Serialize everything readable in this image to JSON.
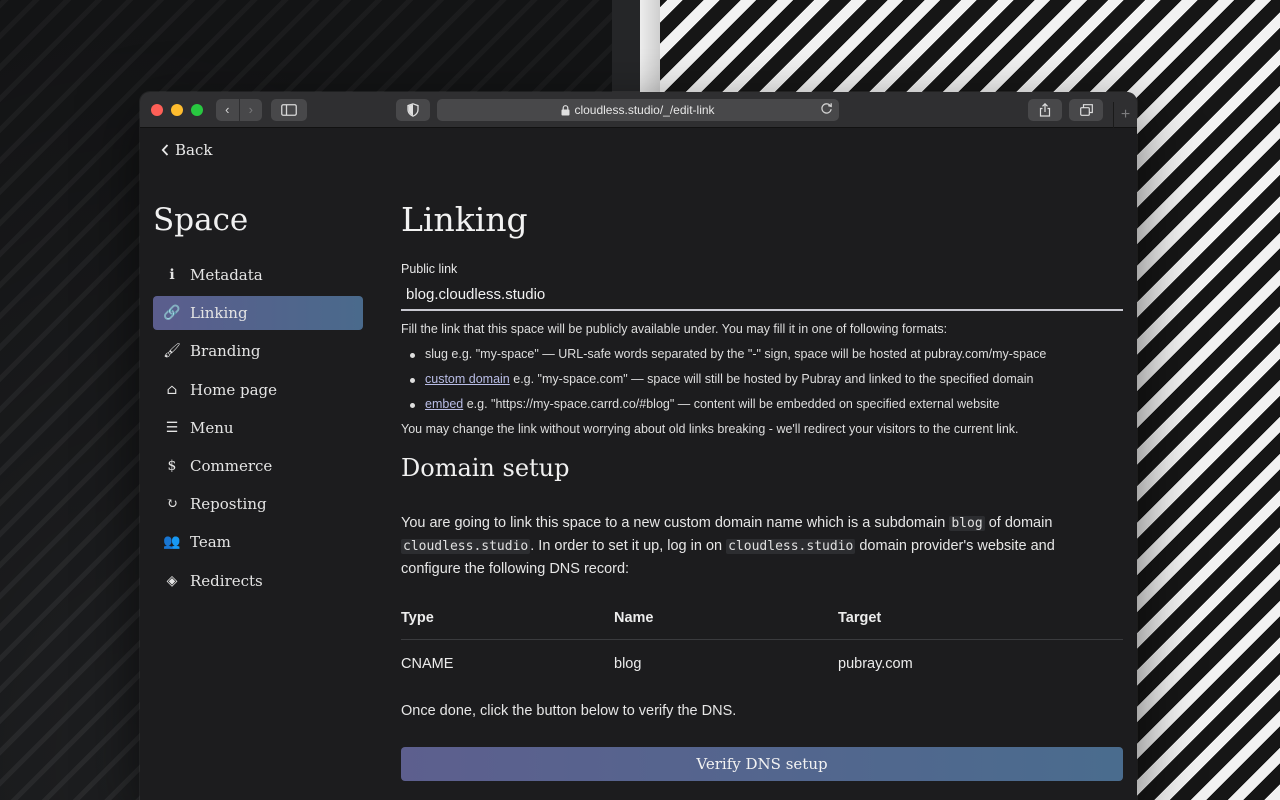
{
  "browser": {
    "url": "cloudless.studio/_/edit-link",
    "nav_back_glyph": "‹",
    "nav_forward_glyph": "›",
    "new_tab_glyph": "+"
  },
  "page": {
    "back_label": "Back",
    "space_title": "Space"
  },
  "sidebar": {
    "items": [
      {
        "label": "Metadata",
        "icon": "info-icon",
        "glyph": "ℹ"
      },
      {
        "label": "Linking",
        "icon": "link-icon",
        "glyph": "🔗",
        "active": true
      },
      {
        "label": "Branding",
        "icon": "brush-icon",
        "glyph": "🖌"
      },
      {
        "label": "Home page",
        "icon": "home-icon",
        "glyph": "⌂"
      },
      {
        "label": "Menu",
        "icon": "menu-icon",
        "glyph": "☰"
      },
      {
        "label": "Commerce",
        "icon": "dollar-icon",
        "glyph": "$"
      },
      {
        "label": "Reposting",
        "icon": "redo-icon",
        "glyph": "↻"
      },
      {
        "label": "Team",
        "icon": "users-icon",
        "glyph": "👥"
      },
      {
        "label": "Redirects",
        "icon": "directions-icon",
        "glyph": "◈"
      }
    ]
  },
  "linking": {
    "title": "Linking",
    "public_link_label": "Public link",
    "public_link_value": "blog.cloudless.studio",
    "intro": "Fill the link that this space will be publicly available under. You may fill it in one of following formats:",
    "formats": [
      {
        "link": "",
        "text": "slug e.g. \"my-space\" — URL-safe words separated by the \"-\" sign, space will be hosted at pubray.com/my-space"
      },
      {
        "link": "custom domain",
        "text": " e.g. \"my-space.com\" — space will still be hosted by Pubray and linked to the specified domain"
      },
      {
        "link": "embed",
        "text": " e.g. \"https://my-space.carrd.co/#blog\" — content will be embedded on specified external website"
      }
    ],
    "note": "You may change the link without worrying about old links breaking - we'll redirect your visitors to the current link."
  },
  "domain_setup": {
    "title": "Domain setup",
    "desc_1": "You are going to link this space to a new custom domain name which is a subdomain ",
    "subdomain": "blog",
    "desc_2": " of domain ",
    "domain": "cloudless.studio",
    "desc_3": ". In order to set it up, log in on ",
    "desc_4": " domain provider's website and configure the following DNS record:",
    "table": {
      "headers": [
        "Type",
        "Name",
        "Target"
      ],
      "rows": [
        [
          "CNAME",
          "blog",
          "pubray.com"
        ]
      ]
    },
    "done_text": "Once done, click the button below to verify the DNS.",
    "verify_button": "Verify DNS setup"
  }
}
